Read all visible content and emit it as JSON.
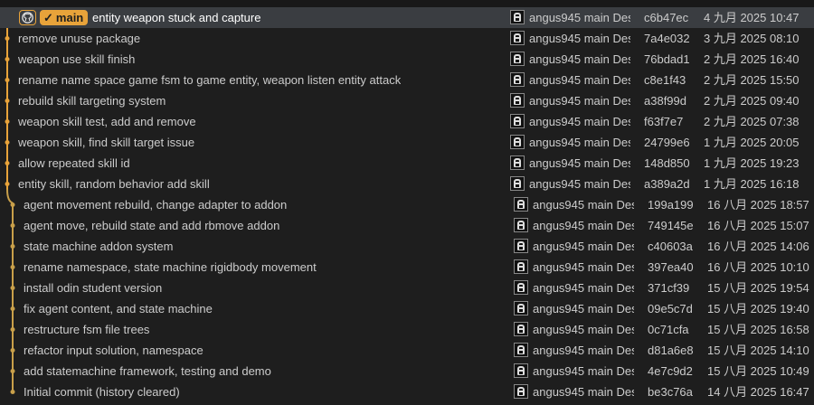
{
  "head_refs": {
    "repo_icon": "github-icon",
    "branch_check_icon": "check-icon",
    "branch_label": "main"
  },
  "commits": [
    {
      "message": "entity weapon stuck and capture",
      "author": "angus945 main Des",
      "hash": "c6b47ec",
      "date": "4 九月 2025 10:47",
      "lane": 0,
      "head": true
    },
    {
      "message": "remove unuse package",
      "author": "angus945 main Des",
      "hash": "7a4e032",
      "date": "3 九月 2025 08:10",
      "lane": 0
    },
    {
      "message": "weapon use skill finish",
      "author": "angus945 main Des",
      "hash": "76bdad1",
      "date": "2 九月 2025 16:40",
      "lane": 0
    },
    {
      "message": "rename name space game fsm to game entity, weapon listen entity attack",
      "author": "angus945 main Des",
      "hash": "c8e1f43",
      "date": "2 九月 2025 15:50",
      "lane": 0
    },
    {
      "message": "rebuild skill targeting system",
      "author": "angus945 main Des",
      "hash": "a38f99d",
      "date": "2 九月 2025 09:40",
      "lane": 0
    },
    {
      "message": "weapon skill test, add and remove",
      "author": "angus945 main Des",
      "hash": "f63f7e7",
      "date": "2 九月 2025 07:38",
      "lane": 0
    },
    {
      "message": "weapon skill, find skill target issue",
      "author": "angus945 main Des",
      "hash": "24799e6",
      "date": "1 九月 2025 20:05",
      "lane": 0
    },
    {
      "message": "allow repeated skill id",
      "author": "angus945 main Des",
      "hash": "148d850",
      "date": "1 九月 2025 19:23",
      "lane": 0
    },
    {
      "message": "entity skill, random behavior add skill",
      "author": "angus945 main Des",
      "hash": "a389a2d",
      "date": "1 九月 2025 16:18",
      "lane": 0
    },
    {
      "message": "agent movement rebuild, change adapter to addon",
      "author": "angus945 main Des",
      "hash": "199a199",
      "date": "16 八月 2025 18:57",
      "lane": 1
    },
    {
      "message": "agent move, rebuild state and add rbmove addon",
      "author": "angus945 main Des",
      "hash": "749145e",
      "date": "16 八月 2025 15:07",
      "lane": 1
    },
    {
      "message": "state machine addon system",
      "author": "angus945 main Des",
      "hash": "c40603a",
      "date": "16 八月 2025 14:06",
      "lane": 1
    },
    {
      "message": "rename namespace, state machine rigidbody movement",
      "author": "angus945 main Des",
      "hash": "397ea40",
      "date": "16 八月 2025 10:10",
      "lane": 1
    },
    {
      "message": "install odin student version",
      "author": "angus945 main Des",
      "hash": "371cf39",
      "date": "15 八月 2025 19:54",
      "lane": 1
    },
    {
      "message": "fix agent content, and state machine",
      "author": "angus945 main Des",
      "hash": "09e5c7d",
      "date": "15 八月 2025 19:40",
      "lane": 1
    },
    {
      "message": "restructure fsm file trees",
      "author": "angus945 main Des",
      "hash": "0c71cfa",
      "date": "15 八月 2025 16:58",
      "lane": 1
    },
    {
      "message": "refactor input solution, namespace",
      "author": "angus945 main Des",
      "hash": "d81a6e8",
      "date": "15 八月 2025 14:10",
      "lane": 1
    },
    {
      "message": "add statemachine framework, testing and demo",
      "author": "angus945 main Des",
      "hash": "4e7c9d2",
      "date": "15 八月 2025 10:49",
      "lane": 1
    },
    {
      "message": "Initial commit (history cleared)",
      "author": "angus945 main Des",
      "hash": "be3c76a",
      "date": "14 八月 2025 16:47",
      "lane": 1
    }
  ],
  "colors": {
    "lane0": "#e8a33a",
    "lane1": "#c9a04a",
    "head_row_bg": "#3a3d41",
    "background": "#1e1e1e"
  }
}
